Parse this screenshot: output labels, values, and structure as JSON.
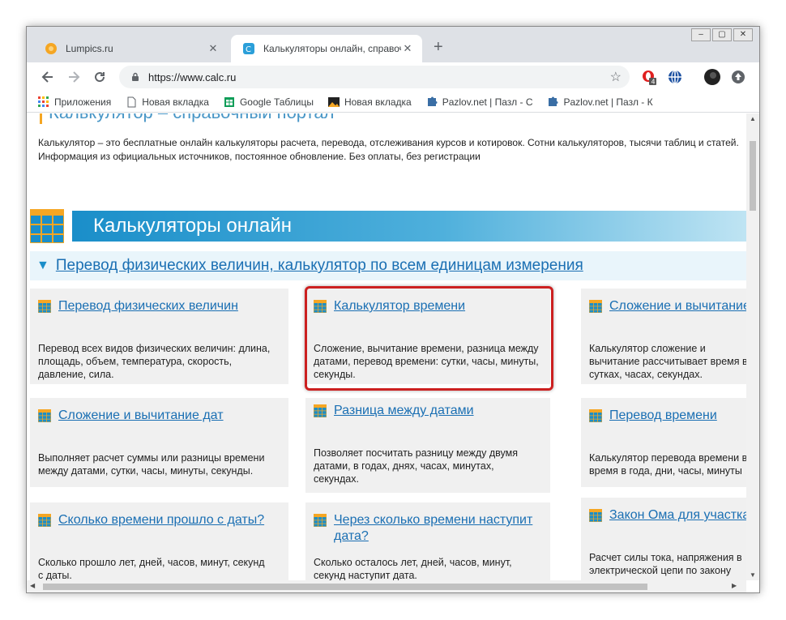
{
  "browser": {
    "tabs": [
      {
        "title": "Lumpics.ru",
        "active": false
      },
      {
        "title": "Калькуляторы онлайн, справоч",
        "active": true
      }
    ],
    "new_tab": "+",
    "window_controls": {
      "minimize": "–",
      "restore": "▢",
      "close": "✕"
    },
    "tab_close": "✕",
    "address": "https://www.calc.ru",
    "extension_badge": "4",
    "bookmarks": [
      {
        "label": "Приложения",
        "icon": "apps-grid-icon"
      },
      {
        "label": "Новая вкладка",
        "icon": "page-icon"
      },
      {
        "label": "Google Таблицы",
        "icon": "sheets-icon"
      },
      {
        "label": "Новая вкладка",
        "icon": "image-icon"
      },
      {
        "label": "Pazlov.net | Пазл - С",
        "icon": "puzzle-icon"
      },
      {
        "label": "Pazlov.net | Пазл - К",
        "icon": "puzzle-icon"
      }
    ]
  },
  "page": {
    "heading_partial": "Калькулятор – справочный портал",
    "intro": "Калькулятор – это бесплатные онлайн калькуляторы расчета, перевода, отслеживания курсов и котировок. Сотни калькуляторов, тысячи таблиц и статей. Информация из официальных источников, постоянное обновление. Без оплаты, без регистрации",
    "section_title": "Калькуляторы онлайн",
    "category_link": "Перевод физических величин, калькулятор по всем единицам измерения",
    "cards": [
      {
        "title": "Перевод физических величин",
        "desc": "Перевод всех видов физических величин: длина, площадь, объем, температура, скорость, давление, сила."
      },
      {
        "title": "Калькулятор времени",
        "desc": "Сложение, вычитание времени, разница между датами, перевод времени: сутки, часы, минуты, секунды."
      },
      {
        "title": "Сложение и вычитание",
        "desc": "Калькулятор сложение и вычитание рассчитывает время в сутках, часах, секундах."
      },
      {
        "title": "Сложение и вычитание дат",
        "desc": "Выполняет расчет суммы или разницы времени между датами, сутки, часы, минуты, секунды."
      },
      {
        "title": "Разница между датами",
        "desc": "Позволяет посчитать разницу между двумя датами, в годах, днях, часах, минутах, секундах."
      },
      {
        "title": "Перевод времени",
        "desc": "Калькулятор перевода времени в время в года, дни, часы, минуты"
      },
      {
        "title": "Сколько времени прошло с даты?",
        "desc": "Сколько прошло лет, дней, часов, минут, секунд с даты."
      },
      {
        "title": "Через сколько времени наступит дата?",
        "desc": "Сколько осталось лет, дней, часов, минут, секунд наступит дата."
      },
      {
        "title": "Закон Ома для участка",
        "desc": "Расчет силы тока, напряжения в электрической цепи по закону участка цепи."
      }
    ]
  },
  "colors": {
    "link": "#1a6fb3",
    "banner": "#1a8ec9",
    "accent": "#f5a623",
    "highlight": "#cc2020"
  }
}
